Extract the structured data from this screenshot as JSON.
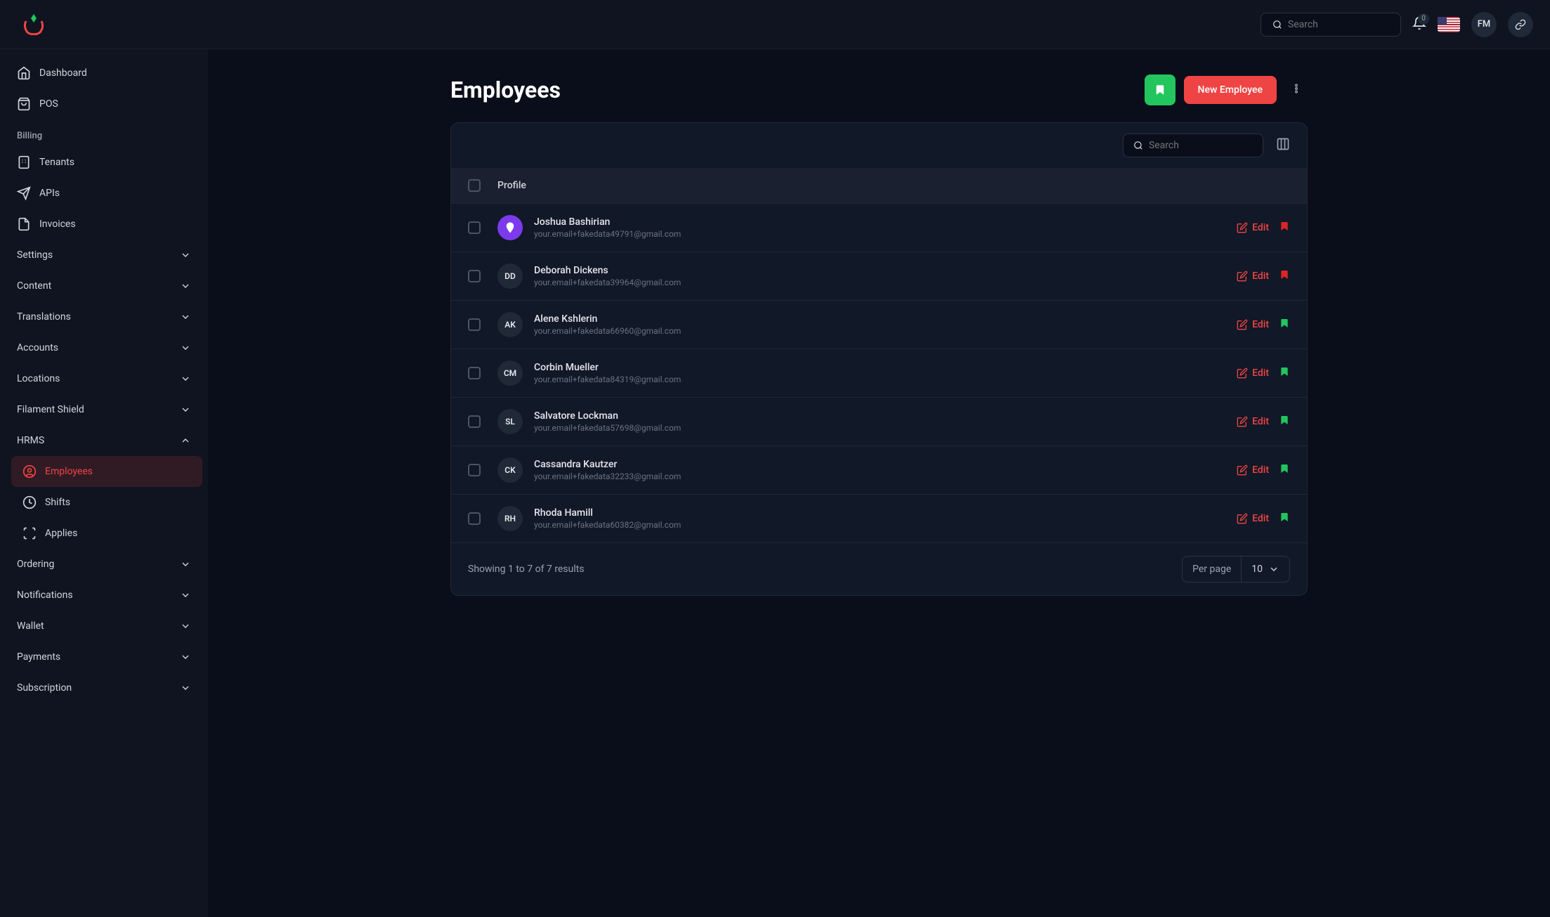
{
  "header": {
    "search_placeholder": "Search",
    "notification_count": "0",
    "user_initials": "FM"
  },
  "sidebar": {
    "top_items": [
      {
        "label": "Dashboard",
        "icon": "home"
      },
      {
        "label": "POS",
        "icon": "shopping-bag"
      }
    ],
    "billing_label": "Billing",
    "billing_items": [
      {
        "label": "Tenants",
        "icon": "building"
      },
      {
        "label": "APIs",
        "icon": "send"
      },
      {
        "label": "Invoices",
        "icon": "file"
      }
    ],
    "collapse_groups": [
      {
        "label": "Settings"
      },
      {
        "label": "Content"
      },
      {
        "label": "Translations"
      },
      {
        "label": "Accounts"
      },
      {
        "label": "Locations"
      },
      {
        "label": "Filament Shield"
      }
    ],
    "hrms_label": "HRMS",
    "hrms_items": [
      {
        "label": "Employees",
        "icon": "user-circle",
        "active": true
      },
      {
        "label": "Shifts",
        "icon": "clock"
      },
      {
        "label": "Applies",
        "icon": "scan"
      }
    ],
    "bottom_groups": [
      {
        "label": "Ordering"
      },
      {
        "label": "Notifications"
      },
      {
        "label": "Wallet"
      },
      {
        "label": "Payments"
      },
      {
        "label": "Subscription"
      }
    ]
  },
  "page": {
    "title": "Employees",
    "new_button": "New Employee"
  },
  "table": {
    "search_placeholder": "Search",
    "header_profile": "Profile",
    "rows": [
      {
        "initials": "",
        "avatar_class": "purple",
        "name": "Joshua Bashirian",
        "email": "your.email+fakedata49791@gmail.com",
        "bookmark": "red"
      },
      {
        "initials": "DD",
        "avatar_class": "",
        "name": "Deborah Dickens",
        "email": "your.email+fakedata39964@gmail.com",
        "bookmark": "red"
      },
      {
        "initials": "AK",
        "avatar_class": "",
        "name": "Alene Kshlerin",
        "email": "your.email+fakedata66960@gmail.com",
        "bookmark": "green"
      },
      {
        "initials": "CM",
        "avatar_class": "",
        "name": "Corbin Mueller",
        "email": "your.email+fakedata84319@gmail.com",
        "bookmark": "green"
      },
      {
        "initials": "SL",
        "avatar_class": "",
        "name": "Salvatore Lockman",
        "email": "your.email+fakedata57698@gmail.com",
        "bookmark": "green"
      },
      {
        "initials": "CK",
        "avatar_class": "",
        "name": "Cassandra Kautzer",
        "email": "your.email+fakedata32233@gmail.com",
        "bookmark": "green"
      },
      {
        "initials": "RH",
        "avatar_class": "",
        "name": "Rhoda Hamill",
        "email": "your.email+fakedata60382@gmail.com",
        "bookmark": "green"
      }
    ],
    "edit_label": "Edit",
    "results_text": "Showing 1 to 7 of 7 results",
    "per_page_label": "Per page",
    "per_page_value": "10"
  }
}
